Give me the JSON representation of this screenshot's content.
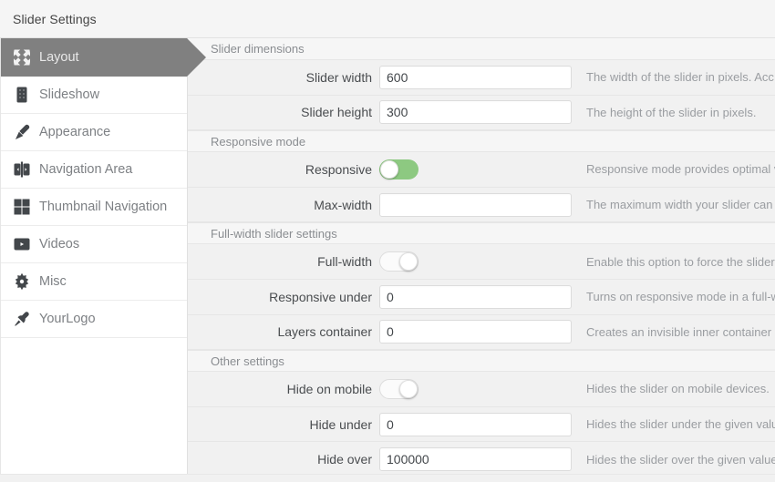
{
  "window": {
    "title": "Slider Settings"
  },
  "sidebar": {
    "items": [
      {
        "label": "Layout",
        "icon": "layout-arrows-icon",
        "active": true
      },
      {
        "label": "Slideshow",
        "icon": "film-strip-icon",
        "active": false
      },
      {
        "label": "Appearance",
        "icon": "paintbrush-icon",
        "active": false
      },
      {
        "label": "Navigation Area",
        "icon": "left-right-arrows-icon",
        "active": false
      },
      {
        "label": "Thumbnail Navigation",
        "icon": "grid-squares-icon",
        "active": false
      },
      {
        "label": "Videos",
        "icon": "play-button-icon",
        "active": false
      },
      {
        "label": "Misc",
        "icon": "gear-icon",
        "active": false
      },
      {
        "label": "YourLogo",
        "icon": "pushpin-icon",
        "active": false
      }
    ]
  },
  "colors": {
    "accent_green": "#8dc981",
    "active_nav": "#808080",
    "panel_bg": "#f1f1f1",
    "section_bg": "#f6f6f6"
  },
  "main": {
    "sections": [
      {
        "title": "Slider dimensions",
        "rows": [
          {
            "label": "Slider width",
            "type": "text",
            "value": "600",
            "placeholder": "",
            "description": "The width of the slider in pixels. Acc"
          },
          {
            "label": "Slider height",
            "type": "text",
            "value": "300",
            "placeholder": "",
            "description": "The height of the slider in pixels."
          }
        ]
      },
      {
        "title": "Responsive mode",
        "rows": [
          {
            "label": "Responsive",
            "type": "toggle",
            "state": "on",
            "description": "Responsive mode provides optimal v"
          },
          {
            "label": "Max-width",
            "type": "text",
            "value": "",
            "placeholder": "",
            "description": "The maximum width your slider can "
          }
        ]
      },
      {
        "title": "Full-width slider settings",
        "rows": [
          {
            "label": "Full-width",
            "type": "toggle",
            "state": "off",
            "description": "Enable this option to force the slider"
          },
          {
            "label": "Responsive under",
            "type": "text",
            "value": "0",
            "placeholder": "",
            "description": "Turns on responsive mode in a full-w"
          },
          {
            "label": "Layers container",
            "type": "text",
            "value": "0",
            "placeholder": "",
            "description": "Creates an invisible inner container "
          }
        ]
      },
      {
        "title": "Other settings",
        "rows": [
          {
            "label": "Hide on mobile",
            "type": "toggle",
            "state": "off",
            "description": "Hides the slider on mobile devices."
          },
          {
            "label": "Hide under",
            "type": "text",
            "value": "0",
            "placeholder": "",
            "description": "Hides the slider under the given valu"
          },
          {
            "label": "Hide over",
            "type": "text",
            "value": "100000",
            "placeholder": "",
            "description": "Hides the slider over the given value"
          }
        ]
      }
    ]
  }
}
